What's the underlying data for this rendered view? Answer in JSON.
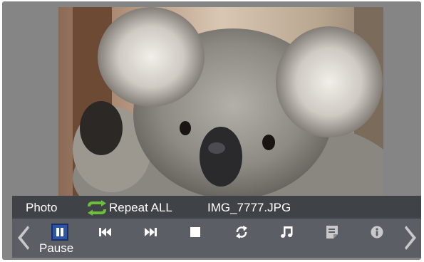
{
  "info_bar": {
    "category": "Photo",
    "repeat_mode": "Repeat ALL",
    "filename": "IMG_7777.JPG"
  },
  "controls": {
    "items": [
      {
        "name": "pause",
        "icon": "pause-icon",
        "selected": true
      },
      {
        "name": "previous",
        "icon": "skip-previous-icon"
      },
      {
        "name": "next",
        "icon": "skip-next-icon"
      },
      {
        "name": "stop",
        "icon": "stop-icon"
      },
      {
        "name": "rotate",
        "icon": "rotate-icon"
      },
      {
        "name": "music",
        "icon": "music-note-icon"
      },
      {
        "name": "memo",
        "icon": "memo-icon"
      },
      {
        "name": "info",
        "icon": "info-icon"
      }
    ],
    "focused_label": "Pause"
  },
  "colors": {
    "frame": "#858585",
    "info_bar_bg": "#3f4247",
    "control_bar_bg": "#5b5f65",
    "selected_button": "#2d55a3",
    "repeat_icon_green": "#6bbf3a",
    "text": "#ffffff"
  }
}
